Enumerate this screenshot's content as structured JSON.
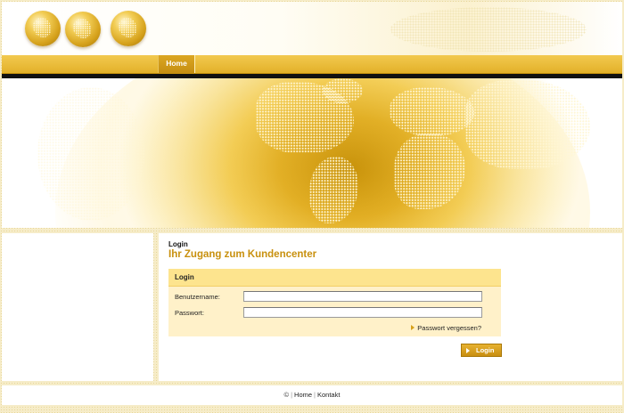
{
  "nav": {
    "home_label": "Home"
  },
  "breadcrumb": "Login",
  "page_title": "Ihr Zugang zum Kundencenter",
  "login_panel": {
    "title": "Login",
    "username_label": "Benutzername:",
    "username_value": "",
    "password_label": "Passwort:",
    "password_value": "",
    "forgot_label": "Passwort vergessen?"
  },
  "login_button_label": "Login",
  "footer": {
    "copyright": "©",
    "separator": "|",
    "home_link": "Home",
    "contact_link": "Kontakt"
  },
  "colors": {
    "accent": "#c8900e",
    "nav_gold": "#e3b129",
    "panel_bg": "#fff1c9",
    "panel_head": "#fde48e"
  },
  "icons": [
    "globe-icon",
    "triangle-right-icon"
  ]
}
